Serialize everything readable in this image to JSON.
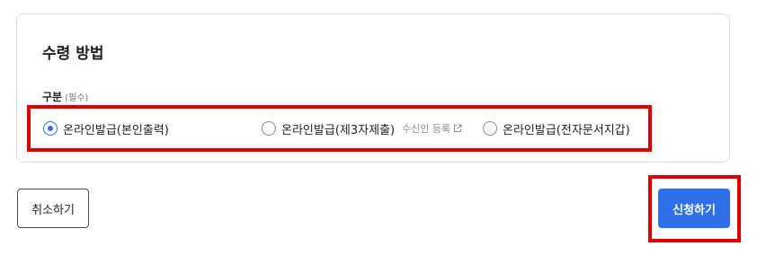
{
  "section": {
    "title": "수령 방법",
    "field_label": "구분",
    "required_label": "(필수)",
    "options": [
      {
        "label": "온라인발급(본인출력)",
        "selected": true
      },
      {
        "label": "온라인발급(제3자제출)",
        "selected": false,
        "link": "수신인 등록",
        "link_icon": "external-link-icon"
      },
      {
        "label": "온라인발급(전자문서지갑)",
        "selected": false
      }
    ]
  },
  "actions": {
    "cancel_label": "취소하기",
    "submit_label": "신청하기"
  },
  "colors": {
    "accent": "#2f6fe8",
    "highlight": "#e00000"
  }
}
